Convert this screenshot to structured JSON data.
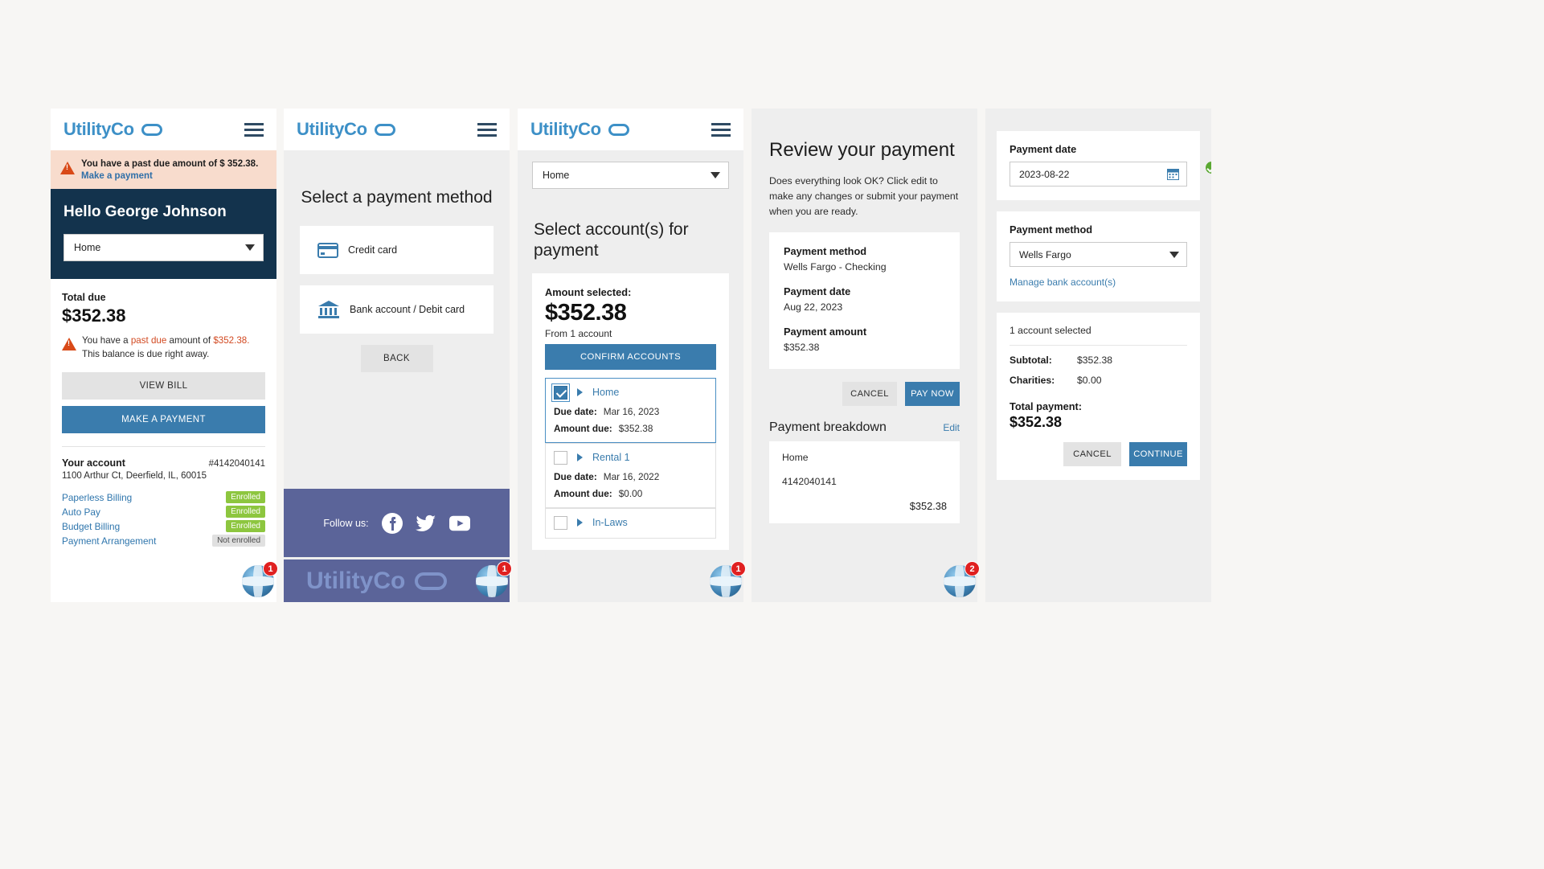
{
  "brand": {
    "name": "UtilityCo",
    "color": "#3d90c7"
  },
  "panel1": {
    "alert": {
      "message": "You have a past due amount of $ 352.38.",
      "link": "Make a payment",
      "icon": "warning-triangle-icon"
    },
    "greeting": "Hello George Johnson",
    "account_select": "Home",
    "total_due_label": "Total due",
    "total_due_amount": "$352.38",
    "past_due_note_1": "You have a ",
    "past_due_highlight": "past due",
    "past_due_note_2": " amount of ",
    "past_due_amount": "$352.38.",
    "past_due_note_3": " This balance is due right away.",
    "view_bill": "VIEW BILL",
    "make_payment": "MAKE A PAYMENT",
    "your_account_label": "Your account",
    "account_number": "#4142040141",
    "address": "1100 Arthur Ct, Deerfield, IL, 60015",
    "enrollments": [
      {
        "label": "Paperless Billing",
        "status": "Enrolled",
        "state": "enrolled"
      },
      {
        "label": "Auto Pay",
        "status": "Enrolled",
        "state": "enrolled"
      },
      {
        "label": "Budget Billing",
        "status": "Enrolled",
        "state": "enrolled"
      },
      {
        "label": "Payment Arrangement",
        "status": "Not enrolled",
        "state": "not-enrolled"
      }
    ],
    "helper_badge": "1"
  },
  "panel2": {
    "title": "Select a payment method",
    "methods": [
      {
        "label": "Credit card",
        "icon": "credit-card-icon"
      },
      {
        "label": "Bank account / Debit card",
        "icon": "bank-icon"
      }
    ],
    "back": "BACK",
    "follow_us": "Follow us:",
    "social": [
      "facebook-icon",
      "twitter-icon",
      "youtube-icon"
    ],
    "footer_brand": "UtilityCo",
    "helper_badge": "1"
  },
  "panel3": {
    "account_select": "Home",
    "title": "Select account(s) for payment",
    "amount_selected_label": "Amount selected:",
    "amount_selected": "$352.38",
    "from_accounts": "From 1 account",
    "confirm_button": "CONFIRM ACCOUNTS",
    "due_date_label": "Due date:",
    "amount_due_label": "Amount due:",
    "accounts": [
      {
        "name": "Home",
        "due_date": "Mar 16, 2023",
        "amount_due": "$352.38",
        "checked": true
      },
      {
        "name": "Rental 1",
        "due_date": "Mar 16, 2022",
        "amount_due": "$0.00",
        "checked": false
      },
      {
        "name": "In-Laws",
        "due_date": "",
        "amount_due": "",
        "checked": false
      }
    ],
    "helper_badge": "1"
  },
  "panel4": {
    "title": "Review your payment",
    "description": "Does everything look OK? Click edit to make any changes or submit your payment when you are ready.",
    "summary": [
      {
        "key": "Payment method",
        "value": "Wells Fargo - Checking"
      },
      {
        "key": "Payment date",
        "value": "Aug 22, 2023"
      },
      {
        "key": "Payment amount",
        "value": "$352.38"
      }
    ],
    "cancel": "CANCEL",
    "pay_now": "PAY NOW",
    "breakdown_title": "Payment breakdown",
    "edit": "Edit",
    "breakdown_account": "Home",
    "breakdown_number": "4142040141",
    "breakdown_amount": "$352.38",
    "helper_badge": "2"
  },
  "panel5": {
    "payment_date_label": "Payment date",
    "payment_date_value": "2023-08-22",
    "date_valid_icon": "check-circle-icon",
    "calendar_icon": "calendar-icon",
    "payment_method_label": "Payment method",
    "payment_method_value": "Wells Fargo",
    "manage_link": "Manage bank account(s)",
    "accounts_selected": "1 account selected",
    "rows": [
      {
        "key": "Subtotal:",
        "value": "$352.38"
      },
      {
        "key": "Charities:",
        "value": "$0.00"
      }
    ],
    "total_label": "Total payment:",
    "total_value": "$352.38",
    "cancel": "CANCEL",
    "continue": "CONTINUE"
  }
}
